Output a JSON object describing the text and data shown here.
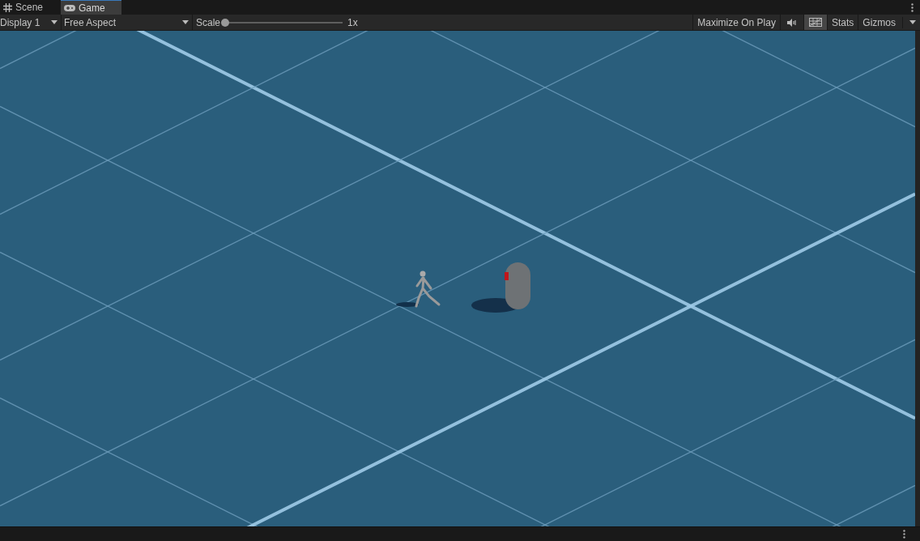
{
  "tabs": [
    {
      "label": "Scene",
      "kind": "grid",
      "selected": false
    },
    {
      "label": "Game",
      "kind": "gamepad",
      "selected": true
    }
  ],
  "toolbar": {
    "display": "Display 1",
    "aspect": "Free Aspect",
    "scale_label": "Scale",
    "scale": {
      "level": 0.0
    },
    "scale_reading": "1x",
    "toggles": [
      {
        "kind": "text",
        "label": "Maximize On Play",
        "on": false
      },
      {
        "kind": "audio",
        "on": false
      },
      {
        "kind": "stats-grid",
        "on": true
      },
      {
        "kind": "text",
        "label": "Stats",
        "on": false
      }
    ],
    "gizmos": "Gizmos"
  }
}
